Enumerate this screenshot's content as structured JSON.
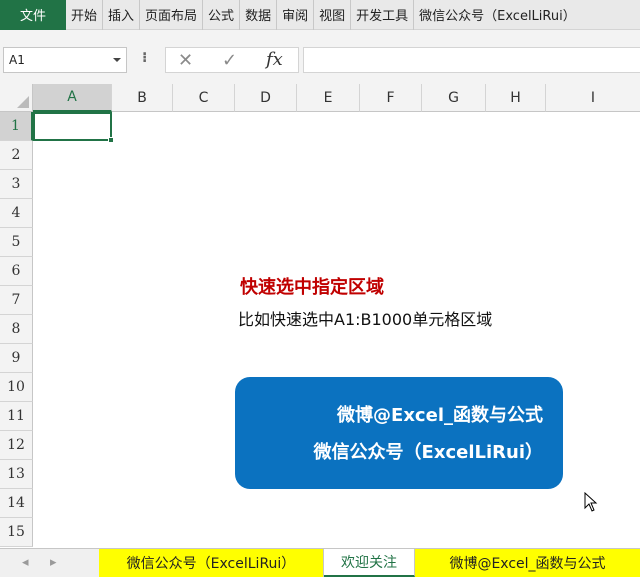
{
  "ribbon": {
    "file_label": "文件",
    "tabs": [
      "开始",
      "插入",
      "页面布局",
      "公式",
      "数据",
      "审阅",
      "视图",
      "开发工具",
      "微信公众号（ExcelLiRui）"
    ]
  },
  "formula_bar": {
    "name_box": "A1",
    "dots": "⁝",
    "cancel_icon": "✕",
    "enter_icon": "✓",
    "fx_label": "fx",
    "formula": ""
  },
  "columns": [
    "A",
    "B",
    "C",
    "D",
    "E",
    "F",
    "G",
    "H",
    "I"
  ],
  "rows": [
    "1",
    "2",
    "3",
    "4",
    "5",
    "6",
    "7",
    "8",
    "9",
    "10",
    "11",
    "12",
    "13",
    "14",
    "15"
  ],
  "selected_cell": "A1",
  "content": {
    "title": "快速选中指定区域",
    "subtitle": "比如快速选中A1:B1000单元格区域"
  },
  "info_box": {
    "line1": "微博@Excel_函数与公式",
    "line2": "微信公众号（ExcelLiRui）",
    "color": "#0b72c0"
  },
  "sheet_tabs": {
    "prev_arrow": "◂",
    "next_arrow": "▸",
    "tabs": [
      "微信公众号（ExcelLiRui）",
      "欢迎关注",
      "微博@Excel_函数与公式"
    ],
    "active_tab": "欢迎关注",
    "highlight_color": "#ffff00"
  },
  "accent_color": "#217346",
  "title_color": "#c00000"
}
